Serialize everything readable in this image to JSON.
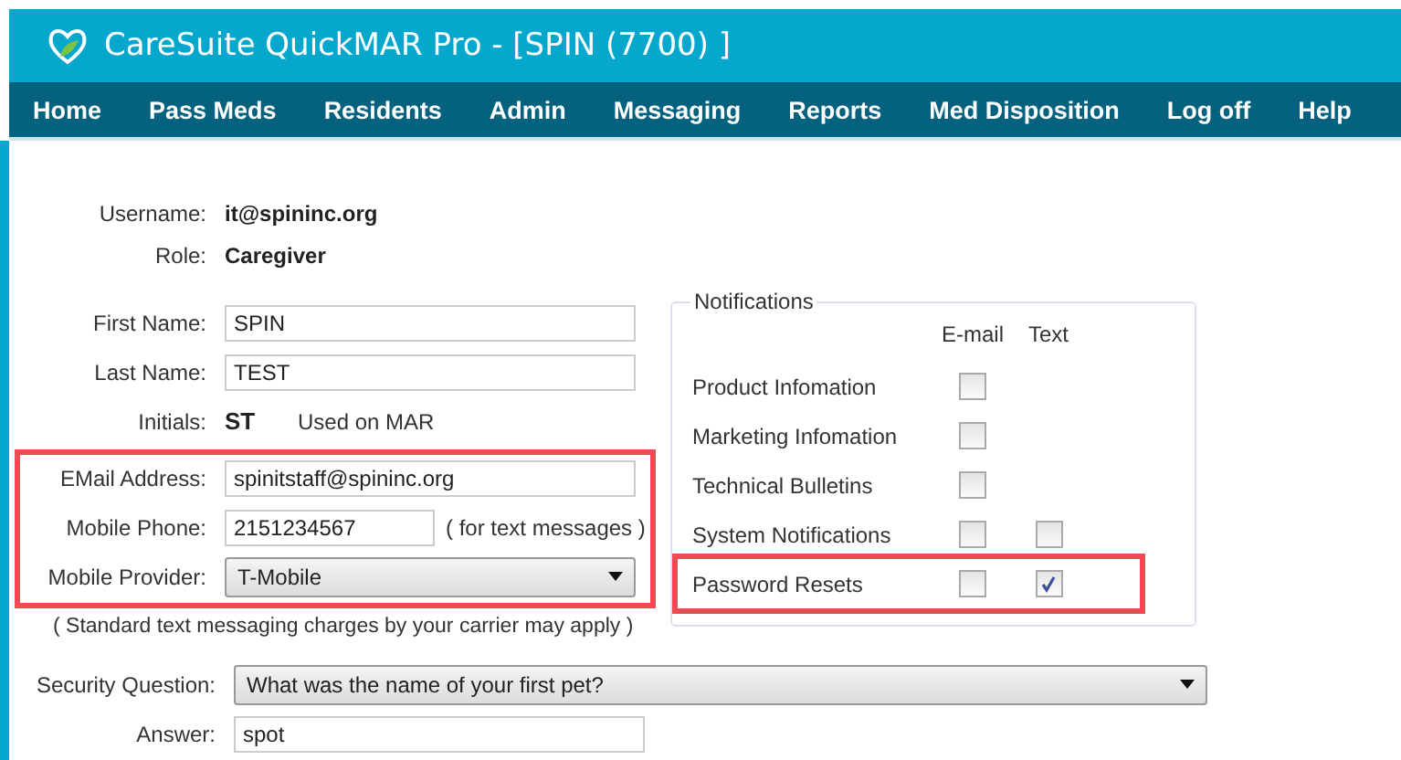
{
  "window": {
    "title": "CareSuite QuickMAR Pro - [SPIN (7700) ]"
  },
  "nav": [
    "Home",
    "Pass Meds",
    "Residents",
    "Admin",
    "Messaging",
    "Reports",
    "Med Disposition",
    "Log off",
    "Help"
  ],
  "account": [
    {
      "label": "Username:",
      "value": "it@spininc.org"
    },
    {
      "label": "Role:",
      "value": "Caregiver"
    }
  ],
  "name_fields": [
    {
      "label": "First Name:",
      "value": "SPIN"
    },
    {
      "label": "Last Name:",
      "value": "TEST"
    }
  ],
  "initials": {
    "label": "Initials:",
    "value": "ST",
    "note": "Used on MAR"
  },
  "contact": {
    "highlighted": true,
    "email": {
      "label": "EMail Address:",
      "value": "spinitstaff@spininc.org"
    },
    "phone": {
      "label": "Mobile Phone:",
      "value": "2151234567",
      "note": "( for text messages )"
    },
    "provider": {
      "label": "Mobile Provider:",
      "value": "T-Mobile"
    }
  },
  "charges_note": "( Standard text messaging charges by your carrier may apply )",
  "notifications": {
    "title": "Notifications",
    "columns": [
      "E-mail",
      "Text"
    ],
    "rows": [
      {
        "label": "Product Infomation",
        "email": false,
        "highlighted": false
      },
      {
        "label": "Marketing Infomation",
        "email": false,
        "highlighted": false
      },
      {
        "label": "Technical Bulletins",
        "email": false,
        "highlighted": false
      },
      {
        "label": "System Notifications",
        "email": false,
        "text": false,
        "highlighted": false
      },
      {
        "label": "Password Resets",
        "email": false,
        "text": true,
        "highlighted": true
      }
    ]
  },
  "security": {
    "question_label": "Security Question:",
    "question": "What was the name of your first pet?",
    "answer_label": "Answer:",
    "answer": "spot"
  }
}
